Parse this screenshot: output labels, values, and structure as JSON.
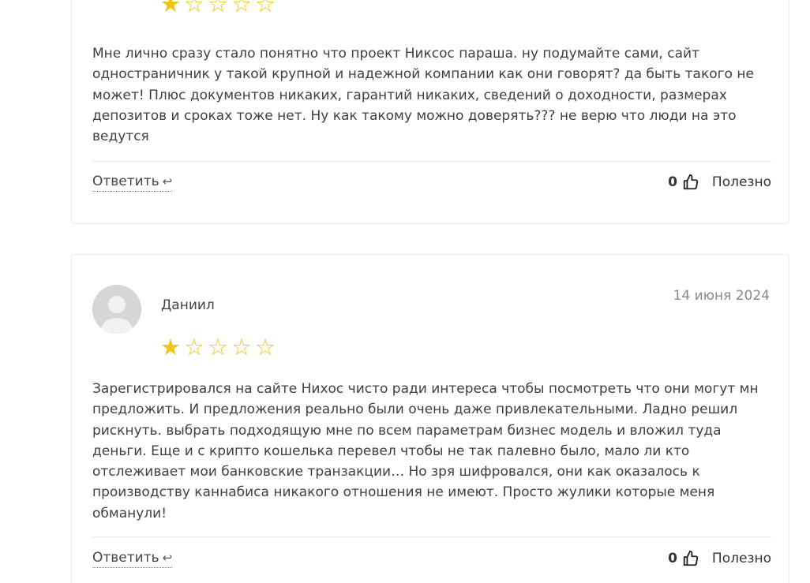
{
  "reviews": [
    {
      "rating": 1,
      "max_rating": 5,
      "text": "Мне лично сразу стало понятно что проект Никсос параша. ну подумайте сами, сайт одностраничник у такой крупной и надежной компании как они говорят? да быть такого не может! Плюс документов никаких, гарантий никаких, сведений о доходности, размерах депозитов и сроках тоже нет. Ну как такому можно доверять??? не верю что люди на это ведутся",
      "reply_label": "Ответить",
      "reply_icon": "reply-arrow-icon",
      "likes": "0",
      "useful_label": "Полезно"
    },
    {
      "author": "Даниил",
      "date": "14 июня 2024",
      "rating": 1,
      "max_rating": 5,
      "text": "Зарегистрировался на сайте Нихос чисто ради интереса чтобы посмотреть что они могут мн предложить. И предложения реально были очень даже привлекательными. Ладно решил рискнуть. выбрать подходящую мне по всем параметрам бизнес модель и вложил туда деньги. Еще и с крипто кошелька перевел чтобы не так палевно было, мало ли кто отслеживает мои банковские транзакции… Но зря шифровался, они как оказалось к производству каннабиса никакого отношения не имеют. Просто жулики которые меня обманули!",
      "reply_label": "Ответить",
      "reply_icon": "reply-arrow-icon",
      "likes": "0",
      "useful_label": "Полезно"
    }
  ],
  "colors": {
    "star": "#f0c419",
    "text": "#404040",
    "date": "#8a8a8a",
    "border": "#ececec"
  }
}
